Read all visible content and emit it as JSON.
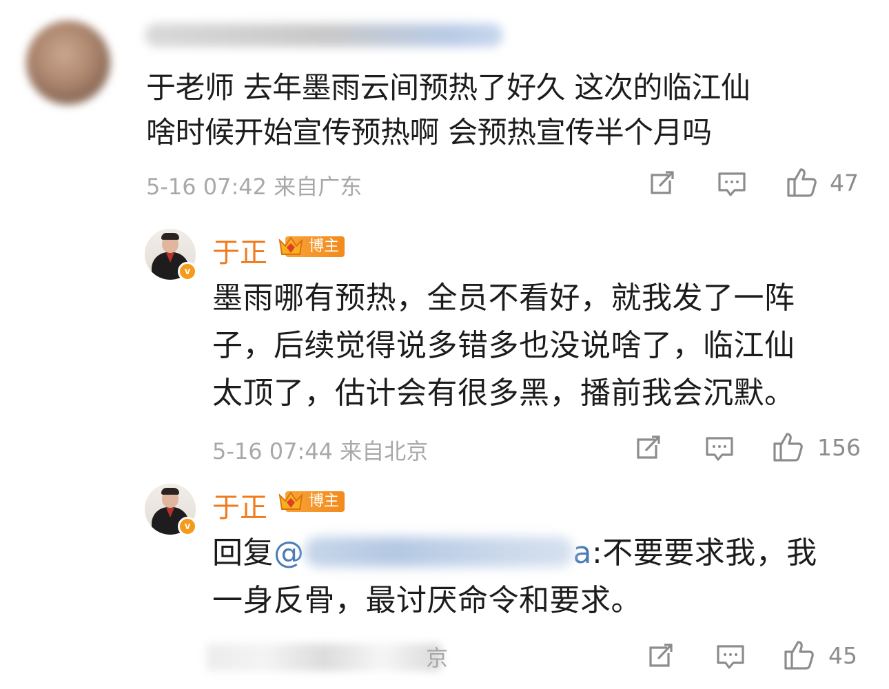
{
  "comment1": {
    "text_line1": "于老师 去年墨雨云间预热了好久 这次的临江仙",
    "text_line2": "啥时候开始宣传预热啊 会预热宣传半个月吗",
    "meta": "5-16 07:42 来自广东",
    "likes": "47"
  },
  "reply1": {
    "author": "于正",
    "tag": "博主",
    "verified": "v",
    "line1": "墨雨哪有预热，全员不看好，就我发了一阵",
    "line2": "子，后续觉得说多错多也没说啥了，临江仙",
    "line3": "太顶了，估计会有很多黑，播前我会沉默。",
    "meta": "5-16 07:44 来自北京",
    "likes": "156"
  },
  "reply2": {
    "author": "于正",
    "tag": "博主",
    "verified": "v",
    "reply_prefix": "回复",
    "mention_at": "@",
    "mention_tail": "a",
    "line1_rest": ":不要要求我，我",
    "line2": "一身反骨，最讨厌命令和要求。",
    "meta_tail": "京",
    "likes": "45"
  },
  "colors": {
    "author": "#f07a1c",
    "mention": "#4a7bb5",
    "meta": "#a8a8a8",
    "icon": "#8c8c8c"
  },
  "icons": [
    "repost-icon",
    "comment-icon",
    "like-icon"
  ]
}
